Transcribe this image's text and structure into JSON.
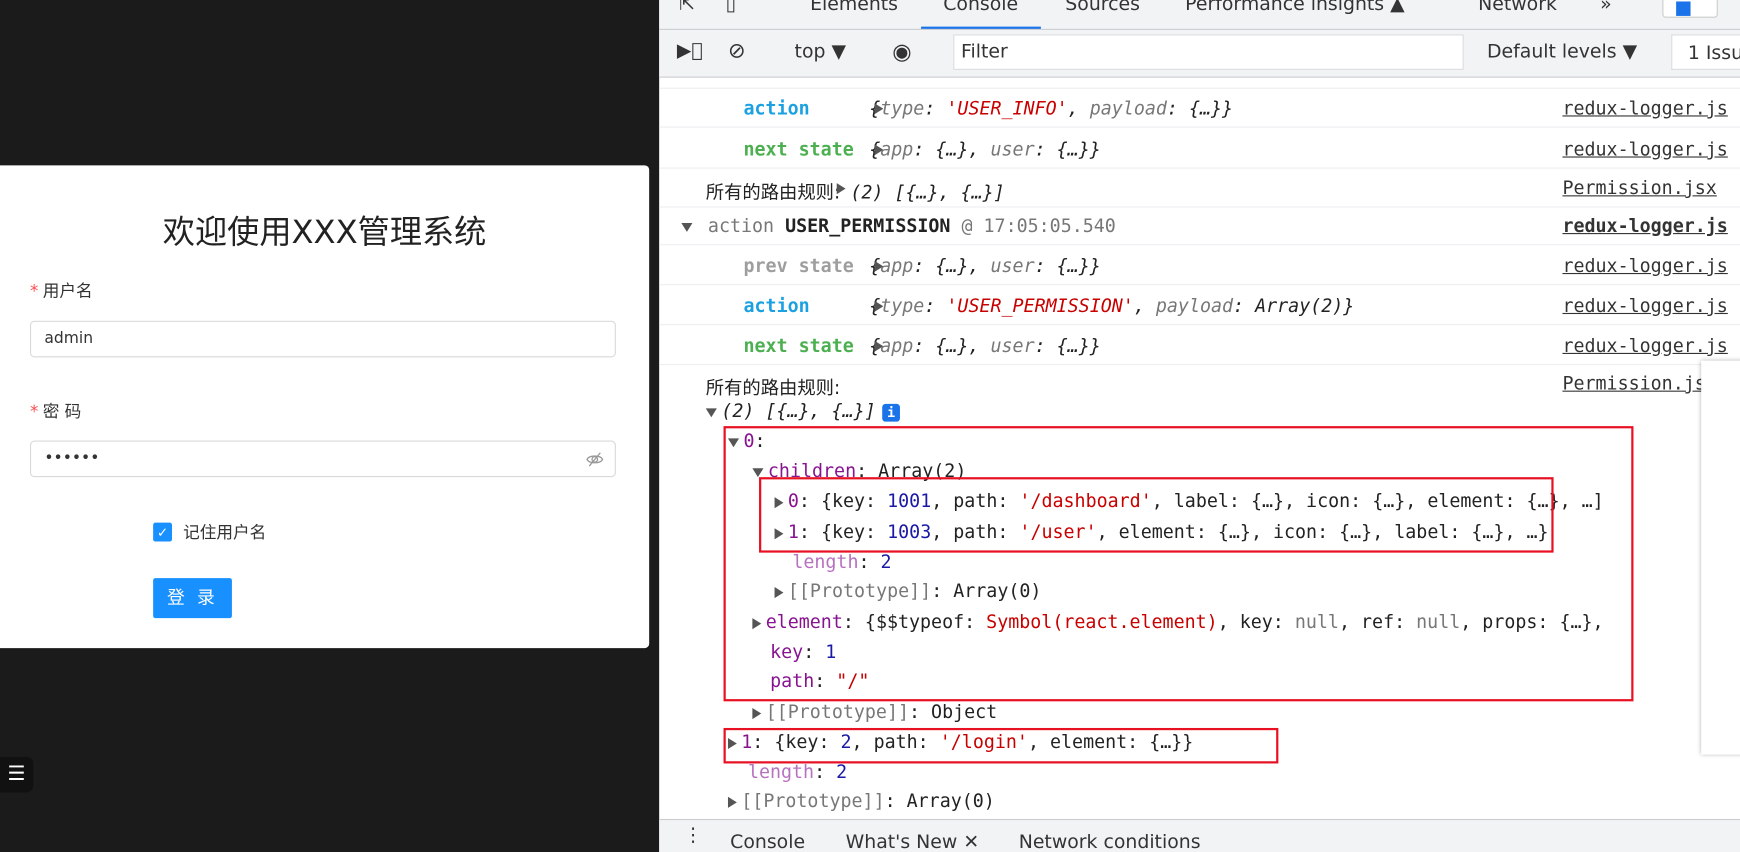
{
  "login": {
    "title": "欢迎使用XXX管理系统",
    "username_label": "用户名",
    "username_value": "admin",
    "password_label": "密 码",
    "password_value": "••••••",
    "remember_label": "记住用户名",
    "remember_checked": true,
    "submit_label": "登 录",
    "required_mark": "*",
    "accent": "#1890ff"
  },
  "devtools": {
    "tabs": [
      "Elements",
      "Console",
      "Sources",
      "Performance insights ▲",
      "Network",
      "»"
    ],
    "active_tab": "Console",
    "context": "top ▼",
    "filter_placeholder": "Filter",
    "levels": "Default levels ▼",
    "issues": "1 Issu",
    "drawer_tabs": [
      "Console",
      "What's New ✕",
      "Network conditions"
    ],
    "rows": [
      {
        "indent": 76,
        "tri": "r",
        "segs": [
          [
            "action     ",
            "c-act"
          ],
          [
            "{",
            "c-it"
          ],
          [
            "type",
            "c-it c-gray"
          ],
          [
            ": ",
            "c-it"
          ],
          [
            "'USER_INFO'",
            "c-it c-str"
          ],
          [
            ", ",
            "c-it"
          ],
          [
            "payload",
            "c-it c-gray"
          ],
          [
            ": {…}}",
            "c-it"
          ]
        ],
        "src": "redux-logger.js"
      },
      {
        "indent": 76,
        "tri": "r",
        "segs": [
          [
            "next state ",
            "c-next"
          ],
          [
            "{",
            "c-it"
          ],
          [
            "app",
            "c-it c-gray"
          ],
          [
            ": {…}, ",
            "c-it"
          ],
          [
            "user",
            "c-it c-gray"
          ],
          [
            ": {…}}",
            "c-it"
          ]
        ],
        "src": "redux-logger.js"
      },
      {
        "indent": 42,
        "tri": "r",
        "segs": [
          [
            "所有的路由规则: ",
            "c-cn"
          ],
          [
            "(2) [{…}, {…}]",
            "c-it"
          ]
        ],
        "src": "Permission.jsx"
      },
      {
        "indent": 20,
        "tri": "d",
        "segs": [
          [
            " action ",
            "c-gray"
          ],
          [
            "USER_PERMISSION",
            "c-bold"
          ],
          [
            " @ 17:05:05.540",
            "c-gray"
          ]
        ],
        "src": "redux-logger.js",
        "bold_src": true
      },
      {
        "indent": 76,
        "tri": "r",
        "segs": [
          [
            "prev state ",
            "c-prev"
          ],
          [
            "{",
            "c-it"
          ],
          [
            "app",
            "c-it c-gray"
          ],
          [
            ": {…}, ",
            "c-it"
          ],
          [
            "user",
            "c-it c-gray"
          ],
          [
            ": {…}}",
            "c-it"
          ]
        ],
        "src": "redux-logger.js"
      },
      {
        "indent": 76,
        "tri": "r",
        "segs": [
          [
            "action     ",
            "c-act"
          ],
          [
            "{",
            "c-it"
          ],
          [
            "type",
            "c-it c-gray"
          ],
          [
            ": ",
            "c-it"
          ],
          [
            "'USER_PERMISSION'",
            "c-it c-str"
          ],
          [
            ", ",
            "c-it"
          ],
          [
            "payload",
            "c-it c-gray"
          ],
          [
            ": Array(2)}",
            "c-it"
          ]
        ],
        "src": "redux-logger.js"
      },
      {
        "indent": 76,
        "tri": "r",
        "segs": [
          [
            "next state ",
            "c-next"
          ],
          [
            "{",
            "c-it"
          ],
          [
            "app",
            "c-it c-gray"
          ],
          [
            ": {…}, ",
            "c-it"
          ],
          [
            "user",
            "c-it c-gray"
          ],
          [
            ": {…}}",
            "c-it"
          ]
        ],
        "src": "redux-logger.js"
      }
    ],
    "log_header": {
      "text": "所有的路由规则:",
      "src": "Permission.jsx"
    },
    "tree": [
      {
        "indent": 42,
        "tri": "d",
        "segs": [
          [
            "(2) [{…}, {…}]",
            "c-it"
          ]
        ],
        "info": "i"
      },
      {
        "indent": 62,
        "tri": "d",
        "segs": [
          [
            "0",
            "c-key"
          ],
          [
            ":",
            ""
          ]
        ]
      },
      {
        "indent": 84,
        "tri": "d",
        "segs": [
          [
            "children",
            "c-key"
          ],
          [
            ": Array(2)",
            ""
          ]
        ]
      },
      {
        "indent": 104,
        "tri": "r",
        "segs": [
          [
            "0",
            "c-key"
          ],
          [
            ": {key: ",
            ""
          ],
          [
            "1001",
            "c-num"
          ],
          [
            ", path: ",
            ""
          ],
          [
            "'/dashboard'",
            "c-str"
          ],
          [
            ", label: {…}, icon: {…}, element: {…}, …]",
            ""
          ]
        ]
      },
      {
        "indent": 104,
        "tri": "r",
        "segs": [
          [
            "1",
            "c-key"
          ],
          [
            ": {key: ",
            ""
          ],
          [
            "1003",
            "c-num"
          ],
          [
            ", path: ",
            ""
          ],
          [
            "'/user'",
            "c-str"
          ],
          [
            ", element: {…}, icon: {…}, label: {…}, …}",
            ""
          ]
        ]
      },
      {
        "indent": 120,
        "segs": [
          [
            "length",
            "c-dim"
          ],
          [
            ": ",
            ""
          ],
          [
            "2",
            "c-num"
          ]
        ]
      },
      {
        "indent": 104,
        "tri": "r",
        "segs": [
          [
            "[[Prototype]]",
            "c-gray"
          ],
          [
            ": Array(0)",
            ""
          ]
        ]
      },
      {
        "indent": 84,
        "tri": "r",
        "segs": [
          [
            "element",
            "c-key"
          ],
          [
            ": {$$typeof: ",
            ""
          ],
          [
            "Symbol(react.element)",
            "c-str"
          ],
          [
            ", key: ",
            ""
          ],
          [
            "null",
            "c-gray"
          ],
          [
            ", ref: ",
            ""
          ],
          [
            "null",
            "c-gray"
          ],
          [
            ", props: {…},",
            ""
          ]
        ]
      },
      {
        "indent": 100,
        "segs": [
          [
            "key",
            "c-key"
          ],
          [
            ": ",
            ""
          ],
          [
            "1",
            "c-num"
          ]
        ]
      },
      {
        "indent": 100,
        "segs": [
          [
            "path",
            "c-key"
          ],
          [
            ": ",
            ""
          ],
          [
            "\"/\"",
            "c-str"
          ]
        ]
      },
      {
        "indent": 84,
        "tri": "r",
        "segs": [
          [
            "[[Prototype]]",
            "c-gray"
          ],
          [
            ": Object",
            ""
          ]
        ]
      },
      {
        "indent": 62,
        "tri": "r",
        "segs": [
          [
            "1",
            "c-key"
          ],
          [
            ": {key: ",
            ""
          ],
          [
            "2",
            "c-num"
          ],
          [
            ", path: ",
            ""
          ],
          [
            "'/login'",
            "c-str"
          ],
          [
            ", element: {…}}",
            ""
          ]
        ]
      },
      {
        "indent": 80,
        "segs": [
          [
            "length",
            "c-dim"
          ],
          [
            ": ",
            ""
          ],
          [
            "2",
            "c-num"
          ]
        ]
      },
      {
        "indent": 62,
        "tri": "r",
        "segs": [
          [
            "[[Prototype]]",
            "c-gray"
          ],
          [
            ": Array(0)",
            ""
          ]
        ]
      }
    ],
    "highlight_color": "#e81123"
  }
}
